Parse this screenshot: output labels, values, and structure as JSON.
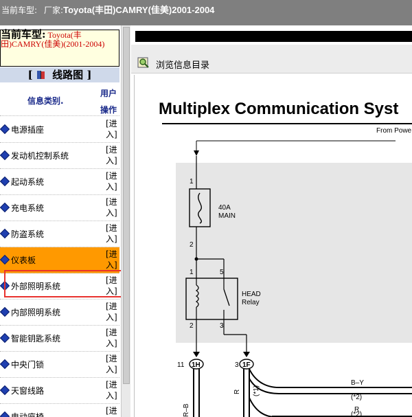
{
  "titlebar": {
    "current_car_label": "当前车型:",
    "maker_label": "厂家:",
    "maker_value": "Toyota(丰田)CAMRY(佳美)2001-2004"
  },
  "sidebar": {
    "car_label": "当前车型:",
    "car_value": "Toyota(丰田)CAMRY(佳美)(2001-2004)",
    "section_open": "[",
    "section_title": "线路图",
    "section_close": "]",
    "col_category": "信息类别.",
    "col_user_op": "用户操作",
    "action_label": "[进入]",
    "items": [
      {
        "label": "电源插座"
      },
      {
        "label": "发动机控制系统"
      },
      {
        "label": "起动系统"
      },
      {
        "label": "充电系统"
      },
      {
        "label": "防盗系统"
      },
      {
        "label": "仪表板"
      },
      {
        "label": "外部照明系统"
      },
      {
        "label": "内部照明系统"
      },
      {
        "label": "智能钥匙系统"
      },
      {
        "label": "中央门锁"
      },
      {
        "label": "天窗线路"
      },
      {
        "label": "电动座椅"
      }
    ],
    "active_index": 5
  },
  "viewer": {
    "browse_label": "浏览信息目录",
    "doc_title": "Multiplex Communication Syst",
    "from_power": "From Powe",
    "fuse_label_1": "40A",
    "fuse_label_2": "MAIN",
    "relay_label_1": "HEAD",
    "relay_label_2": "Relay",
    "pin_1": "1",
    "pin_2": "2",
    "pin_1b": "1",
    "pin_5": "5",
    "pin_2b": "2",
    "pin_3": "3",
    "conn_1_num": "11",
    "conn_1_id": "1H",
    "conn_2_num": "3",
    "conn_2_id": "1F",
    "wire_rb": "R–B",
    "wire_r": "R",
    "wire_r_note": "(*1)",
    "wire_by": "B–Y",
    "wire_by_note": "(*2)",
    "wire_r2": "R",
    "wire_r2_note": "(*2)"
  },
  "colors": {
    "active_row": "#ff9900",
    "highlight": "#e8312d",
    "car_text": "#cc0000",
    "nav_blue": "#1f3fb0"
  }
}
